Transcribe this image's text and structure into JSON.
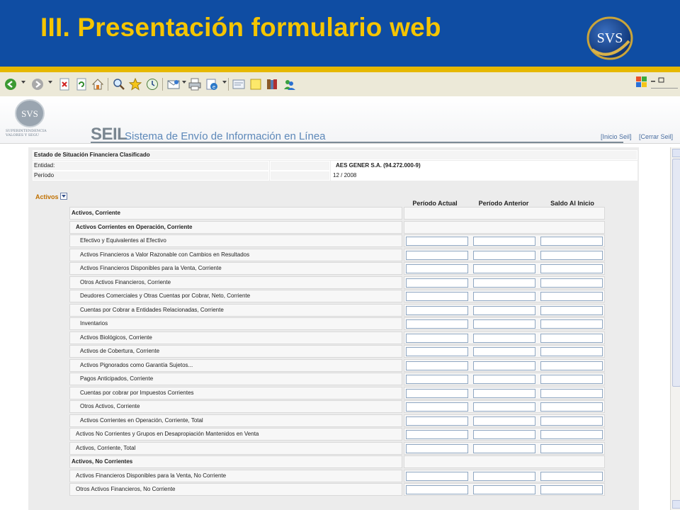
{
  "slide": {
    "title": "III. Presentación formulario web",
    "logo_text": "SVS",
    "colors": {
      "header_bg": "#0f4da3",
      "title": "#f5c500",
      "band": "#e6b800"
    }
  },
  "toolbar": {
    "icons": [
      "back-icon",
      "forward-icon",
      "stop-icon",
      "refresh-icon",
      "home-icon",
      "search-icon",
      "favorites-icon",
      "history-icon",
      "mail-icon",
      "print-icon",
      "edit-icon",
      "discuss-icon",
      "notes-icon",
      "research-icon",
      "messenger-icon"
    ],
    "window_controls": [
      "minimize",
      "restore"
    ]
  },
  "banner": {
    "logo_text": "SVS",
    "logo_caption": "SUPERINTENDENCIA VALORES Y SEGU",
    "seil": "SEIL",
    "subtitle": "Sistema de Envío de Información en Línea",
    "links": [
      "[Inicio Seil]",
      "[Cerrar Seil]"
    ]
  },
  "form": {
    "title": "Estado de Situación Financiera Clasificado",
    "entity_label": "Entidad:",
    "entity_value": "AES GENER S.A. (94.272.000-9)",
    "period_label": "Período",
    "period_value": "12 / 2008",
    "section": "Activos",
    "columns": [
      "Período Actual",
      "Período Anterior",
      "Saldo Al Inicio"
    ],
    "rows": [
      {
        "label": "Activos, Corriente",
        "bold": true,
        "inputs": false
      },
      {
        "label": "Activos Corrientes en Operación, Corriente",
        "bold": true,
        "inputs": false
      },
      {
        "label": "Efectivo y Equivalentes al Efectivo",
        "inputs": true
      },
      {
        "label": "Activos Financieros a Valor Razonable con Cambios en Resultados",
        "inputs": true
      },
      {
        "label": "Activos Financieros Disponibles para la Venta, Corriente",
        "inputs": true
      },
      {
        "label": "Otros Activos Financieros, Corriente",
        "inputs": true
      },
      {
        "label": "Deudores Comerciales y Otras Cuentas por Cobrar, Neto, Corriente",
        "inputs": true
      },
      {
        "label": "Cuentas por Cobrar a Entidades Relacionadas, Corriente",
        "inputs": true
      },
      {
        "label": "Inventarios",
        "inputs": true
      },
      {
        "label": "Activos Biológicos, Corriente",
        "inputs": true
      },
      {
        "label": "Activos de Cobertura, Corriente",
        "inputs": true
      },
      {
        "label": "Activos Pignorados como Garantía Sujetos...",
        "inputs": true
      },
      {
        "label": "Pagos Anticipados, Corriente",
        "inputs": true
      },
      {
        "label": "Cuentas por cobrar por Impuestos Corrientes",
        "inputs": true
      },
      {
        "label": "Otros Activos, Corriente",
        "inputs": true
      },
      {
        "label": "Activos Corrientes en Operación, Corriente, Total",
        "inputs": true
      },
      {
        "label": "Activos No Corrientes y Grupos en Desapropiación Mantenidos en Venta",
        "inputs": true
      },
      {
        "label": "Activos, Corriente, Total",
        "inputs": true
      },
      {
        "label": "Activos, No Corrientes",
        "bold": true,
        "inputs": false
      },
      {
        "label": "Activos Financieros Disponibles para la Venta, No Corriente",
        "inputs": true
      },
      {
        "label": "Otros Activos Financieros, No Corriente",
        "inputs": true
      }
    ]
  }
}
